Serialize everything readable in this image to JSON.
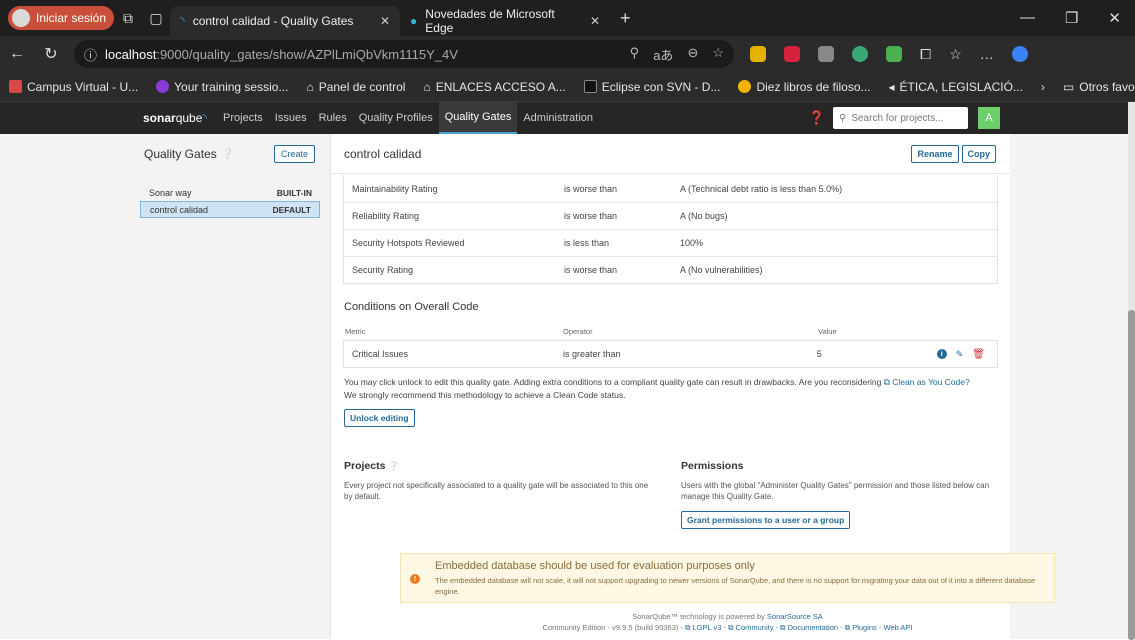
{
  "browser": {
    "profile_label": "Iniciar sesión",
    "tabs": [
      {
        "title": "control calidad - Quality Gates",
        "active": true
      },
      {
        "title": "Novedades de Microsoft Edge",
        "active": false
      }
    ],
    "url_host": "localhost",
    "url_path": ":9000/quality_gates/show/AZPlLmiQbVkm1115Y_4V",
    "bookmarks": [
      "Campus Virtual - U...",
      "Your training sessio...",
      "Panel de control",
      "ENLACES ACCESO A...",
      "Eclipse con SVN - D...",
      "Diez libros de filoso...",
      "ÉTICA, LEGISLACIÓ..."
    ],
    "other_favorites": "Otros favoritos"
  },
  "sonar_nav": {
    "logo_bold": "sonar",
    "logo_rest": "qube",
    "items": [
      "Projects",
      "Issues",
      "Rules",
      "Quality Profiles",
      "Quality Gates",
      "Administration"
    ],
    "active_index": 4,
    "search_placeholder": "Search for projects...",
    "avatar_letter": "A"
  },
  "sidebar": {
    "title": "Quality Gates",
    "create_label": "Create",
    "gates": [
      {
        "name": "Sonar way",
        "tag": "BUILT-IN",
        "selected": false
      },
      {
        "name": "control calidad",
        "tag": "DEFAULT",
        "selected": true
      }
    ]
  },
  "main": {
    "title": "control calidad",
    "rename_label": "Rename",
    "copy_label": "Copy",
    "conditions": [
      {
        "metric": "Maintainability Rating",
        "operator": "is worse than",
        "value": "A  (Technical debt ratio is less than 5.0%)"
      },
      {
        "metric": "Reliability Rating",
        "operator": "is worse than",
        "value": "A  (No bugs)"
      },
      {
        "metric": "Security Hotspots Reviewed",
        "operator": "is less than",
        "value": "100%"
      },
      {
        "metric": "Security Rating",
        "operator": "is worse than",
        "value": "A  (No vulnerabilities)"
      }
    ],
    "overall_title": "Conditions on Overall Code",
    "overall_headers": {
      "metric": "Metric",
      "operator": "Operator",
      "value": "Value"
    },
    "overall_conditions": [
      {
        "metric": "Critical Issues",
        "operator": "is greater than",
        "value": "5"
      }
    ],
    "note_line1": "You may click unlock to edit this quality gate. Adding extra conditions to a compliant quality gate can result in drawbacks. Are you reconsidering",
    "note_link": "Clean as You Code?",
    "note_line2": "We strongly recommend this methodology to achieve a Clean Code status.",
    "unlock_label": "Unlock editing",
    "projects_title": "Projects",
    "projects_text": "Every project not specifically associated to a quality gate will be associated to this one by default.",
    "permissions_title": "Permissions",
    "permissions_text": "Users with the global \"Administer Quality Gates\" permission and those listed below can manage this Quality Gate.",
    "grant_label": "Grant permissions to a user or a group"
  },
  "warning": {
    "title": "Embedded database should be used for evaluation purposes only",
    "text": "The embedded database will not scale, it will not support upgrading to newer versions of SonarQube, and there is no support for migrating your data out of it into a different database engine."
  },
  "footer": {
    "line1_prefix": "SonarQube™ technology is powered by",
    "line1_link": "SonarSource SA",
    "edition": "Community Edition - v9.9.5 (build 90363) -",
    "links": [
      "LGPL v3",
      "Community",
      "Documentation",
      "Plugins",
      "Web API"
    ]
  },
  "colors": {
    "accent": "#236a97",
    "delete": "#d4333f",
    "warning_bg": "#fcf8e3",
    "nav_bg": "#262626"
  }
}
